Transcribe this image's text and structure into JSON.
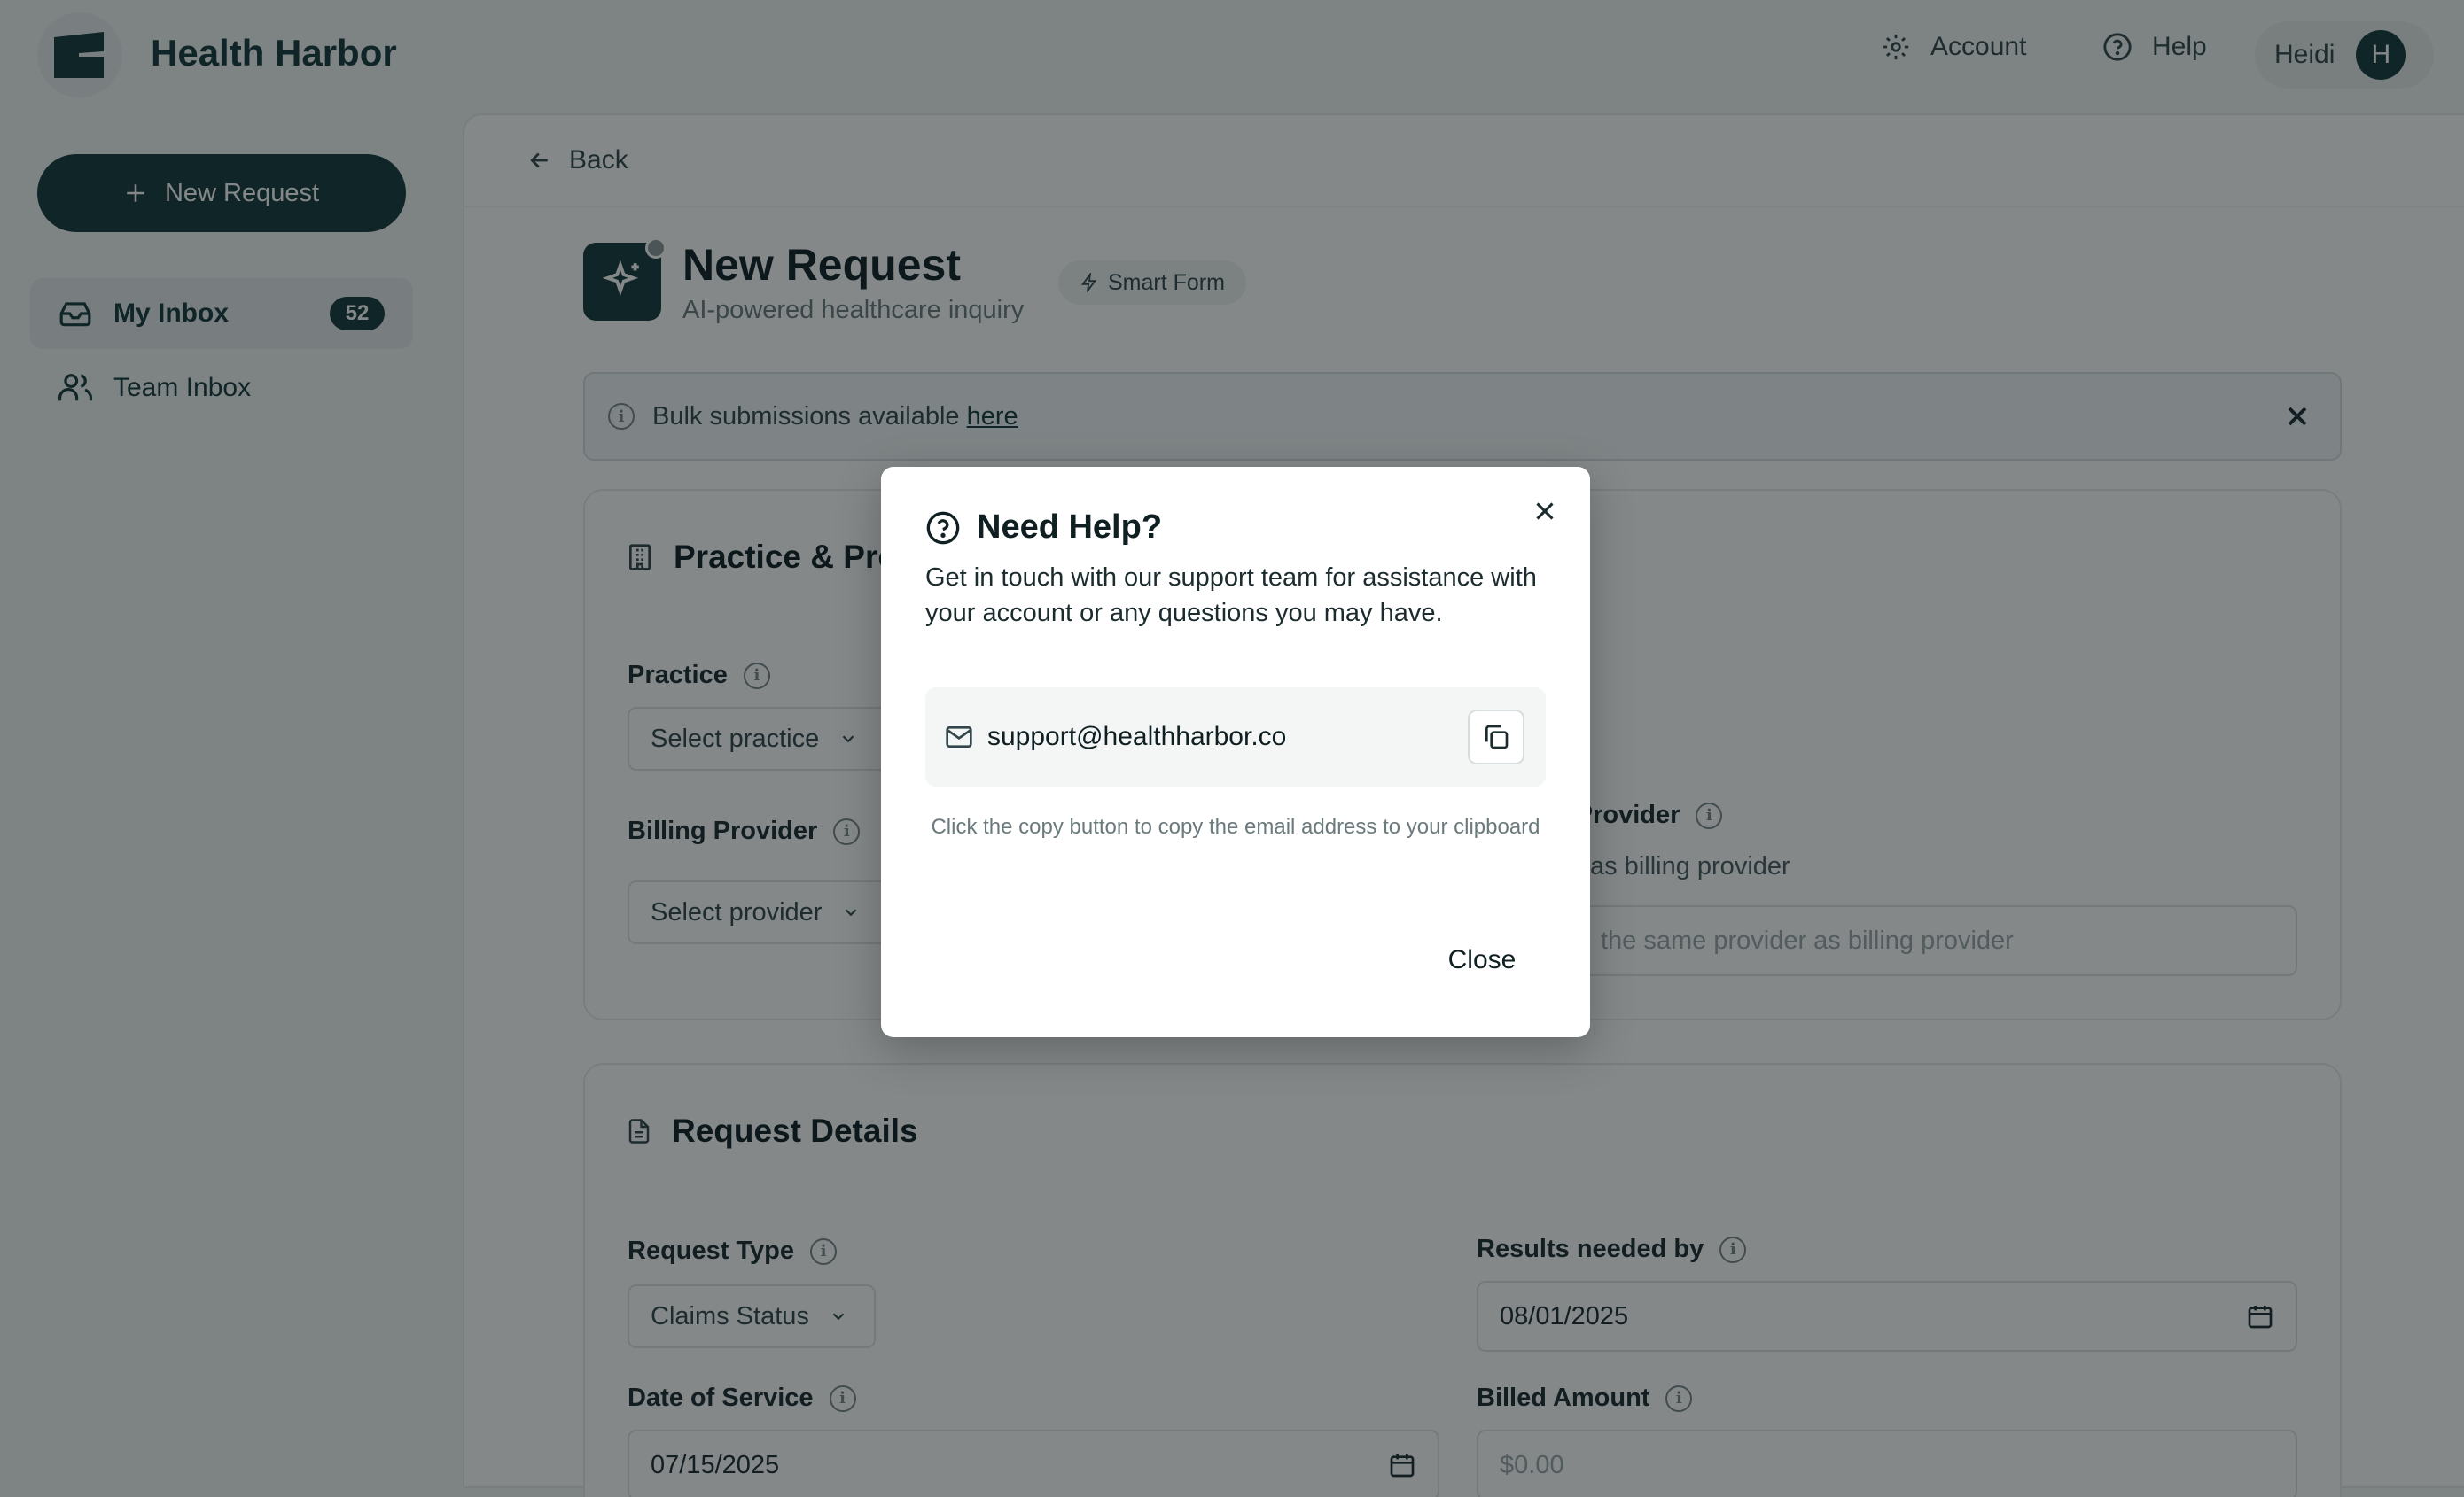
{
  "app": {
    "name": "Health Harbor"
  },
  "topnav": {
    "account_label": "Account",
    "help_label": "Help",
    "user_name": "Heidi",
    "user_initial": "H"
  },
  "sidebar": {
    "new_request_label": "New Request",
    "items": [
      {
        "label": "My Inbox",
        "count": "52",
        "icon": "inbox-icon"
      },
      {
        "label": "Team Inbox",
        "icon": "users-icon"
      }
    ]
  },
  "main": {
    "back_label": "Back",
    "title": "New Request",
    "subtitle": "AI-powered healthcare inquiry",
    "smart_chip": "Smart Form",
    "banner": {
      "text": "Bulk submissions available ",
      "link": "here"
    }
  },
  "practice_card": {
    "title": "Practice & Pro",
    "practice_label": "Practice",
    "practice_placeholder": "Select practice",
    "billing_label": "Billing Provider",
    "billing_placeholder": "Select provider",
    "rendering_label_partial": "g Provider",
    "rendering_checkbox_partial": "as billing provider",
    "rendering_input_partial": "the same provider as billing provider"
  },
  "request_card": {
    "title": "Request Details",
    "request_type_label": "Request Type",
    "request_type_value": "Claims Status",
    "results_label": "Results needed by",
    "results_value": "08/01/2025",
    "dos_label": "Date of Service",
    "dos_value": "07/15/2025",
    "billed_label": "Billed Amount",
    "billed_placeholder": "$0.00"
  },
  "modal": {
    "title": "Need Help?",
    "description": "Get in touch with our support team for assistance with your account or any questions you may have.",
    "email": "support@healthharbor.co",
    "hint": "Click the copy button to copy the email address to your clipboard",
    "close_label": "Close"
  },
  "colors": {
    "brand": "#17393c",
    "overlay": "rgba(10,18,20,0.5)"
  }
}
